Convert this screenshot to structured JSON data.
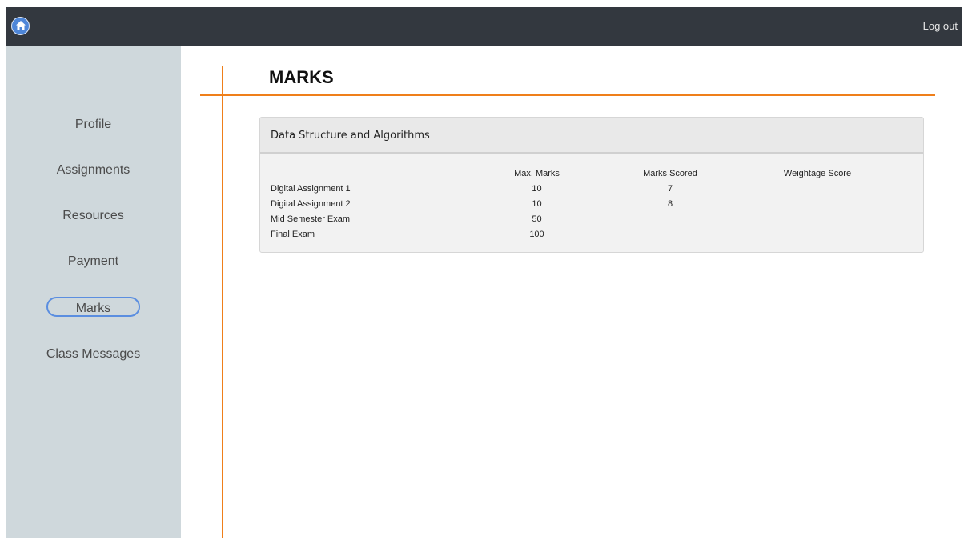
{
  "topbar": {
    "home_icon": "home-icon",
    "logout_label": "Log out"
  },
  "sidebar": {
    "items": [
      {
        "label": "Profile",
        "active": false
      },
      {
        "label": "Assignments",
        "active": false
      },
      {
        "label": "Resources",
        "active": false
      },
      {
        "label": "Payment",
        "active": false
      },
      {
        "label": "Marks",
        "active": true
      },
      {
        "label": "Class Messages",
        "active": false
      }
    ]
  },
  "page": {
    "title": "MARKS"
  },
  "course_card": {
    "title": "Data Structure and Algorithms",
    "columns": [
      "",
      "Max. Marks",
      "Marks Scored",
      "Weightage Score"
    ],
    "rows": [
      {
        "name": "Digital Assignment 1",
        "max": "10",
        "scored": "7",
        "weightage": ""
      },
      {
        "name": "Digital Assignment 2",
        "max": "10",
        "scored": "8",
        "weightage": ""
      },
      {
        "name": "Mid Semester Exam",
        "max": "50",
        "scored": "",
        "weightage": ""
      },
      {
        "name": "Final Exam",
        "max": "100",
        "scored": "",
        "weightage": ""
      }
    ]
  },
  "colors": {
    "topbar": "#33383f",
    "sidebar": "#cfd8dc",
    "accent": "#ef7f1a",
    "active_outline": "#5b8ee0"
  }
}
